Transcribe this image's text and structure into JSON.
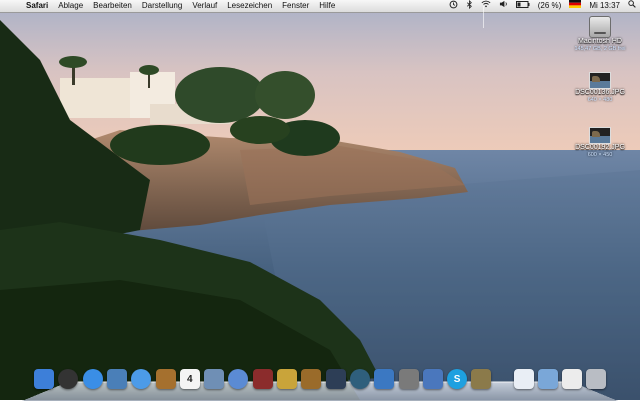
{
  "menubar": {
    "apple": "",
    "app_name": "Safari",
    "menus": [
      "Ablage",
      "Bearbeiten",
      "Darstellung",
      "Verlauf",
      "Lesezeichen",
      "Fenster",
      "Hilfe"
    ],
    "status": {
      "battery": "(26 %)",
      "clock": "Mi 13:37"
    }
  },
  "desktop_icons": [
    {
      "name": "Macintosh HD",
      "info": "145,47 GB, 2 GB frei",
      "icon": "hard-drive-icon"
    },
    {
      "name": "DSC00136.JPG",
      "info": "640 × 480",
      "icon": "image-file-icon"
    },
    {
      "name": "DSC00192.JPG",
      "info": "600 × 450",
      "icon": "image-file-icon"
    }
  ],
  "dock": {
    "apps": [
      {
        "id": "finder",
        "icon": "finder-icon",
        "color": "#3d7fd9"
      },
      {
        "id": "dashboard",
        "icon": "dashboard-icon",
        "color": "#333333"
      },
      {
        "id": "safari",
        "icon": "safari-icon",
        "color": "#3a8ee6"
      },
      {
        "id": "preview",
        "icon": "preview-icon",
        "color": "#4a7fb8"
      },
      {
        "id": "ichat",
        "icon": "ichat-icon",
        "color": "#4c9be8"
      },
      {
        "id": "address-book",
        "icon": "address-book-icon",
        "color": "#a5702e"
      },
      {
        "id": "ical",
        "icon": "ical-icon",
        "color": "#f4f4f4",
        "text": "4"
      },
      {
        "id": "iphoto",
        "icon": "iphoto-icon",
        "color": "#6f8fb5"
      },
      {
        "id": "itunes",
        "icon": "itunes-icon",
        "color": "#5b8bd4"
      },
      {
        "id": "photo-booth",
        "icon": "photo-booth-icon",
        "color": "#8b2c2c"
      },
      {
        "id": "imovie",
        "icon": "imovie-icon",
        "color": "#c9a43a"
      },
      {
        "id": "garageband",
        "icon": "garageband-icon",
        "color": "#9a6b2a"
      },
      {
        "id": "spaces",
        "icon": "spaces-icon",
        "color": "#2d3e56"
      },
      {
        "id": "time-machine",
        "icon": "time-machine-icon",
        "color": "#2f5f7c"
      },
      {
        "id": "system-preferences-figure",
        "icon": "user-figure-icon",
        "color": "#3b78c2"
      },
      {
        "id": "system-preferences",
        "icon": "gear-icon",
        "color": "#7a7a7a"
      },
      {
        "id": "dashcode",
        "icon": "crown-icon",
        "color": "#4a77bd"
      },
      {
        "id": "skype",
        "icon": "skype-icon",
        "color": "#1ea0e0",
        "text": "S"
      },
      {
        "id": "gimp",
        "icon": "gimp-icon",
        "color": "#8b7a4a"
      }
    ],
    "right": [
      {
        "id": "document",
        "icon": "document-icon",
        "color": "#e9eef5"
      },
      {
        "id": "downloads-folder",
        "icon": "folder-icon",
        "color": "#7aa7d8"
      },
      {
        "id": "pictures",
        "icon": "picture-stack-icon",
        "color": "#ececec"
      },
      {
        "id": "trash",
        "icon": "trash-icon",
        "color": "#b9bdc4"
      }
    ]
  }
}
